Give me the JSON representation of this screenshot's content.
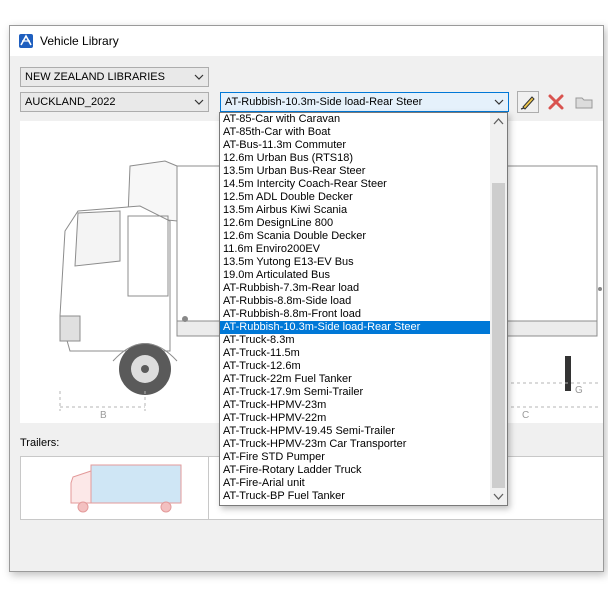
{
  "window": {
    "title": "Vehicle Library",
    "icon": "app-logo-icon"
  },
  "library_select": {
    "value": "NEW ZEALAND LIBRARIES"
  },
  "collection_select": {
    "value": "AUCKLAND_2022"
  },
  "vehicle_select": {
    "value": "AT-Rubbish-10.3m-Side load-Rear Steer",
    "options": [
      "AT-85-Car with Caravan",
      "AT-85th-Car with Boat",
      "AT-Bus-11.3m Commuter",
      "12.6m Urban Bus (RTS18)",
      "13.5m Urban Bus-Rear Steer",
      "14.5m Intercity Coach-Rear Steer",
      "12.5m ADL Double Decker",
      "13.5m Airbus Kiwi Scania",
      "12.6m DesignLine 800",
      "12.6m Scania Double Decker",
      "11.6m Enviro200EV",
      "13.5m Yutong E13-EV Bus",
      "19.0m Articulated Bus",
      "AT-Rubbish-7.3m-Rear load",
      "AT-Rubbis-8.8m-Side load",
      "AT-Rubbish-8.8m-Front load",
      "AT-Rubbish-10.3m-Side load-Rear Steer",
      "AT-Truck-8.3m",
      "AT-Truck-11.5m",
      "AT-Truck-12.6m",
      "AT-Truck-22m Fuel Tanker",
      "AT-Truck-17.9m Semi-Trailer",
      "AT-Truck-HPMV-23m",
      "AT-Truck-HPMV-22m",
      "AT-Truck-HPMV-19.45 Semi-Trailer",
      "AT-Truck-HPMV-23m Car Transporter",
      "AT-Fire STD Pumper",
      "AT-Fire-Rotary Ladder Truck",
      "AT-Fire-Arial unit",
      "AT-Truck-BP Fuel Tanker"
    ],
    "selected_index": 16
  },
  "toolbar": {
    "edit_icon": "edit-pencil-icon",
    "delete_icon": "delete-x-icon",
    "open_icon": "open-folder-icon"
  },
  "preview": {
    "dimension_labels": {
      "b": "B",
      "c": "C",
      "g": "G"
    }
  },
  "trailers": {
    "label": "Trailers:"
  },
  "colors": {
    "selection": "#0078d7",
    "delete_red": "#d9534f",
    "dim_line": "#b4b4b4"
  }
}
